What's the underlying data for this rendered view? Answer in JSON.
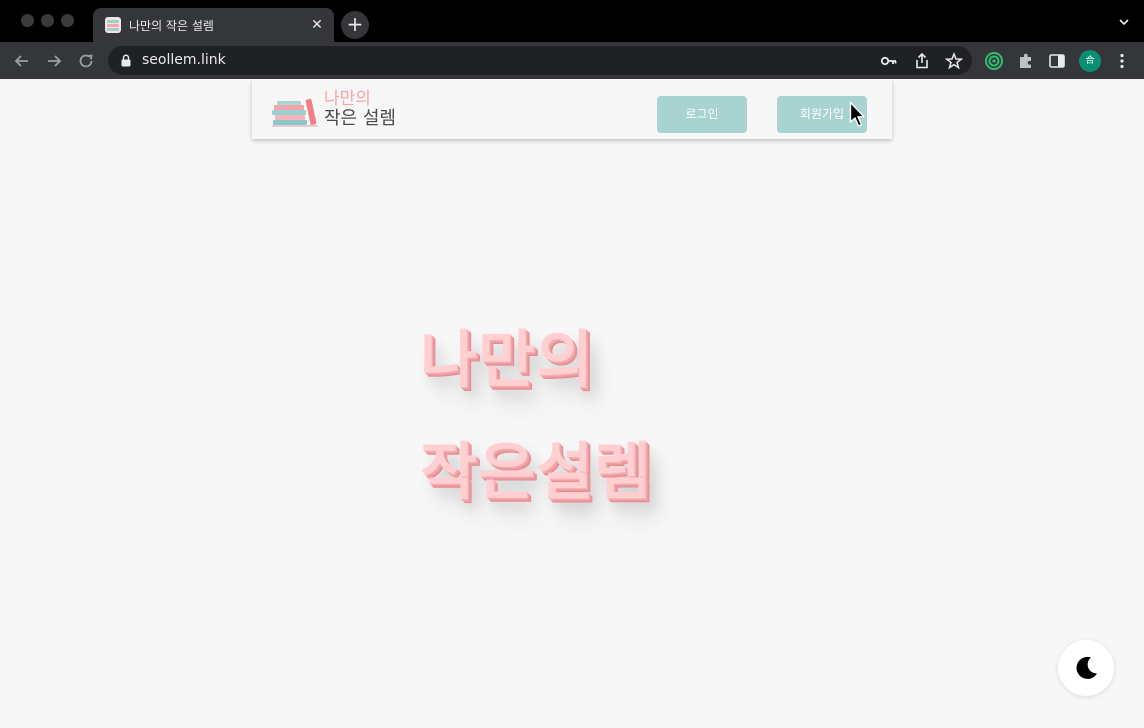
{
  "browser": {
    "tab": {
      "title": "나만의 작은 설렘",
      "close_glyph": "✕"
    },
    "new_tab_glyph": "+",
    "address": {
      "url": "seollem.link"
    },
    "profile_initial": "合"
  },
  "header": {
    "logo": {
      "line1": "나만의",
      "line2": "작은 설렘"
    },
    "login_label": "로그인",
    "signup_label": "회원가입"
  },
  "hero": {
    "line1": "나만의",
    "line2": "작은설렘"
  },
  "icons": {
    "dark_mode_toggle": "moon-icon"
  },
  "colors": {
    "button": "#a8d3d1",
    "hero_text": "#ffcfd1",
    "logo_accent": "#f7a4a8",
    "page_bg": "#f7f7f7"
  }
}
